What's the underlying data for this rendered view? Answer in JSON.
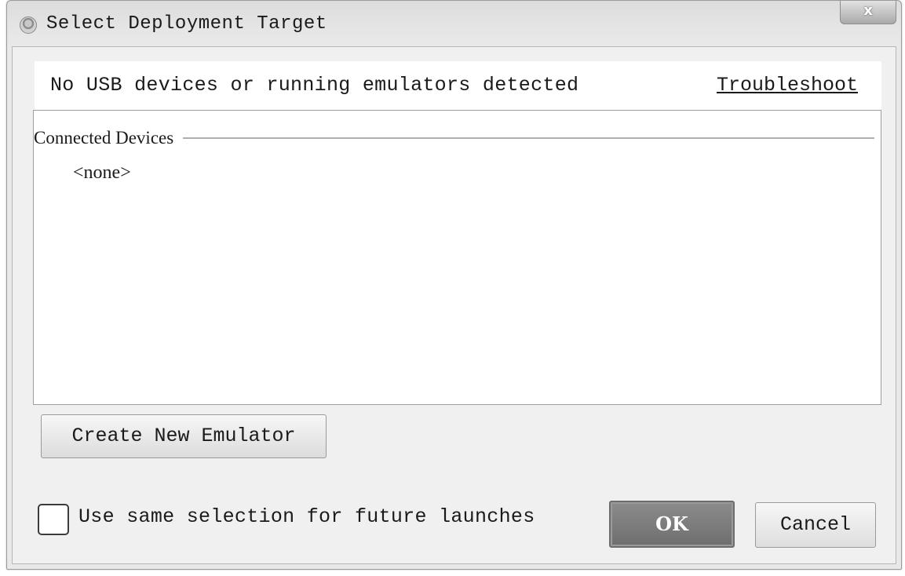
{
  "window": {
    "title": "Select Deployment Target",
    "close_label": "x",
    "title_icon": "android-icon"
  },
  "info_bar": {
    "message": "No USB devices or running emulators detected",
    "link_label": "Troubleshoot"
  },
  "devices": {
    "group_label": "Connected Devices",
    "items": [
      "<none>"
    ]
  },
  "actions": {
    "create_emulator_label": "Create New Emulator",
    "remember_label": "Use same selection for future launches",
    "remember_checked": false,
    "ok_label": "OK",
    "cancel_label": "Cancel"
  }
}
